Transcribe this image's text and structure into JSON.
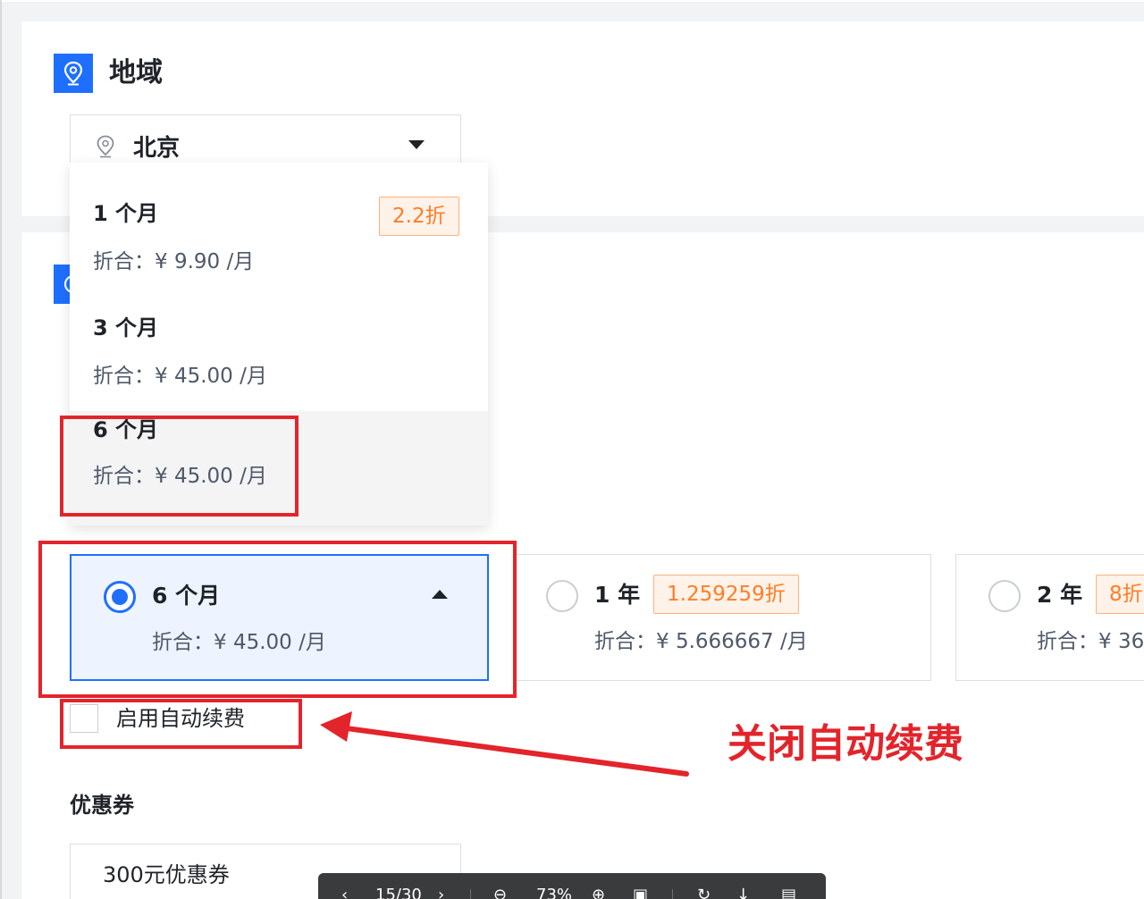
{
  "region_section": {
    "title": "地域",
    "selected_region": "北京",
    "icon": "location-pin-icon"
  },
  "duration_dropdown": {
    "options": [
      {
        "label": "1 个月",
        "price": "折合：¥ 9.90 /月",
        "badge": "2.2折"
      },
      {
        "label": "3 个月",
        "price": "折合：¥ 45.00 /月"
      },
      {
        "label": "6 个月",
        "price": "折合：¥ 45.00 /月"
      }
    ]
  },
  "plans": [
    {
      "label": "6 个月",
      "price": "折合：¥ 45.00 /月",
      "selected": true
    },
    {
      "label": "1 年",
      "price": "折合：¥ 5.666667 /月",
      "badge": "1.259259折",
      "selected": false
    },
    {
      "label": "2 年",
      "price": "折合：¥ 36",
      "badge": "8折",
      "selected": false
    }
  ],
  "auto_renew": {
    "label": "启用自动续费",
    "checked": false
  },
  "coupon": {
    "title": "优惠券",
    "value": "300元优惠券"
  },
  "annotation": {
    "text": "关闭自动续费",
    "color": "#e3242b"
  },
  "viewer_toolbar": {
    "page": "15/30",
    "zoom": "73%"
  },
  "colors": {
    "primary": "#1f6fff",
    "badge_text": "#ff7d27",
    "badge_bg": "#fff2e8",
    "annotation": "#e3242b"
  }
}
